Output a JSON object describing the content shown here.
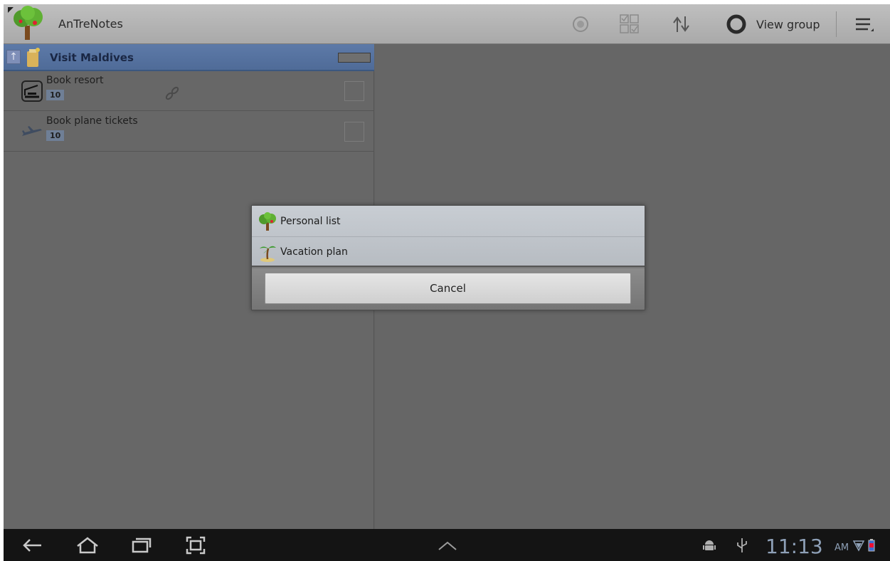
{
  "app": {
    "title": "AnTreNotes",
    "icon": "tree-icon"
  },
  "actionbar": {
    "icons": [
      "add-circle-icon",
      "checklist-grid-icon",
      "sort-arrows-icon",
      "ring-icon",
      "overflow-menu-icon"
    ],
    "view_group_label": "View group"
  },
  "group": {
    "title": "Visit Maldives",
    "up_icon": "up-arrow-icon",
    "note_icon": "note-icon"
  },
  "tasks": [
    {
      "title": "Book resort",
      "badge": "10",
      "icon": "resort-icon",
      "has_link": true
    },
    {
      "title": "Book plane tickets",
      "badge": "10",
      "icon": "plane-icon",
      "has_link": false
    }
  ],
  "dialog": {
    "items": [
      {
        "label": "Personal list",
        "icon": "tree-icon"
      },
      {
        "label": "Vacation plan",
        "icon": "palm-tree-icon"
      }
    ],
    "cancel_label": "Cancel"
  },
  "systembar": {
    "time": "11:13",
    "ampm": "AM",
    "icons": [
      "back-icon",
      "home-icon",
      "recent-apps-icon",
      "screenshot-icon",
      "chevron-up-icon",
      "android-icon",
      "usb-icon",
      "wifi-icon",
      "battery-icon"
    ]
  },
  "colors": {
    "actionbar": "#b4b4b4",
    "group_header": "#5675a4",
    "background": "#636363",
    "systembar": "#141414",
    "clock": "#8ea0b7"
  }
}
